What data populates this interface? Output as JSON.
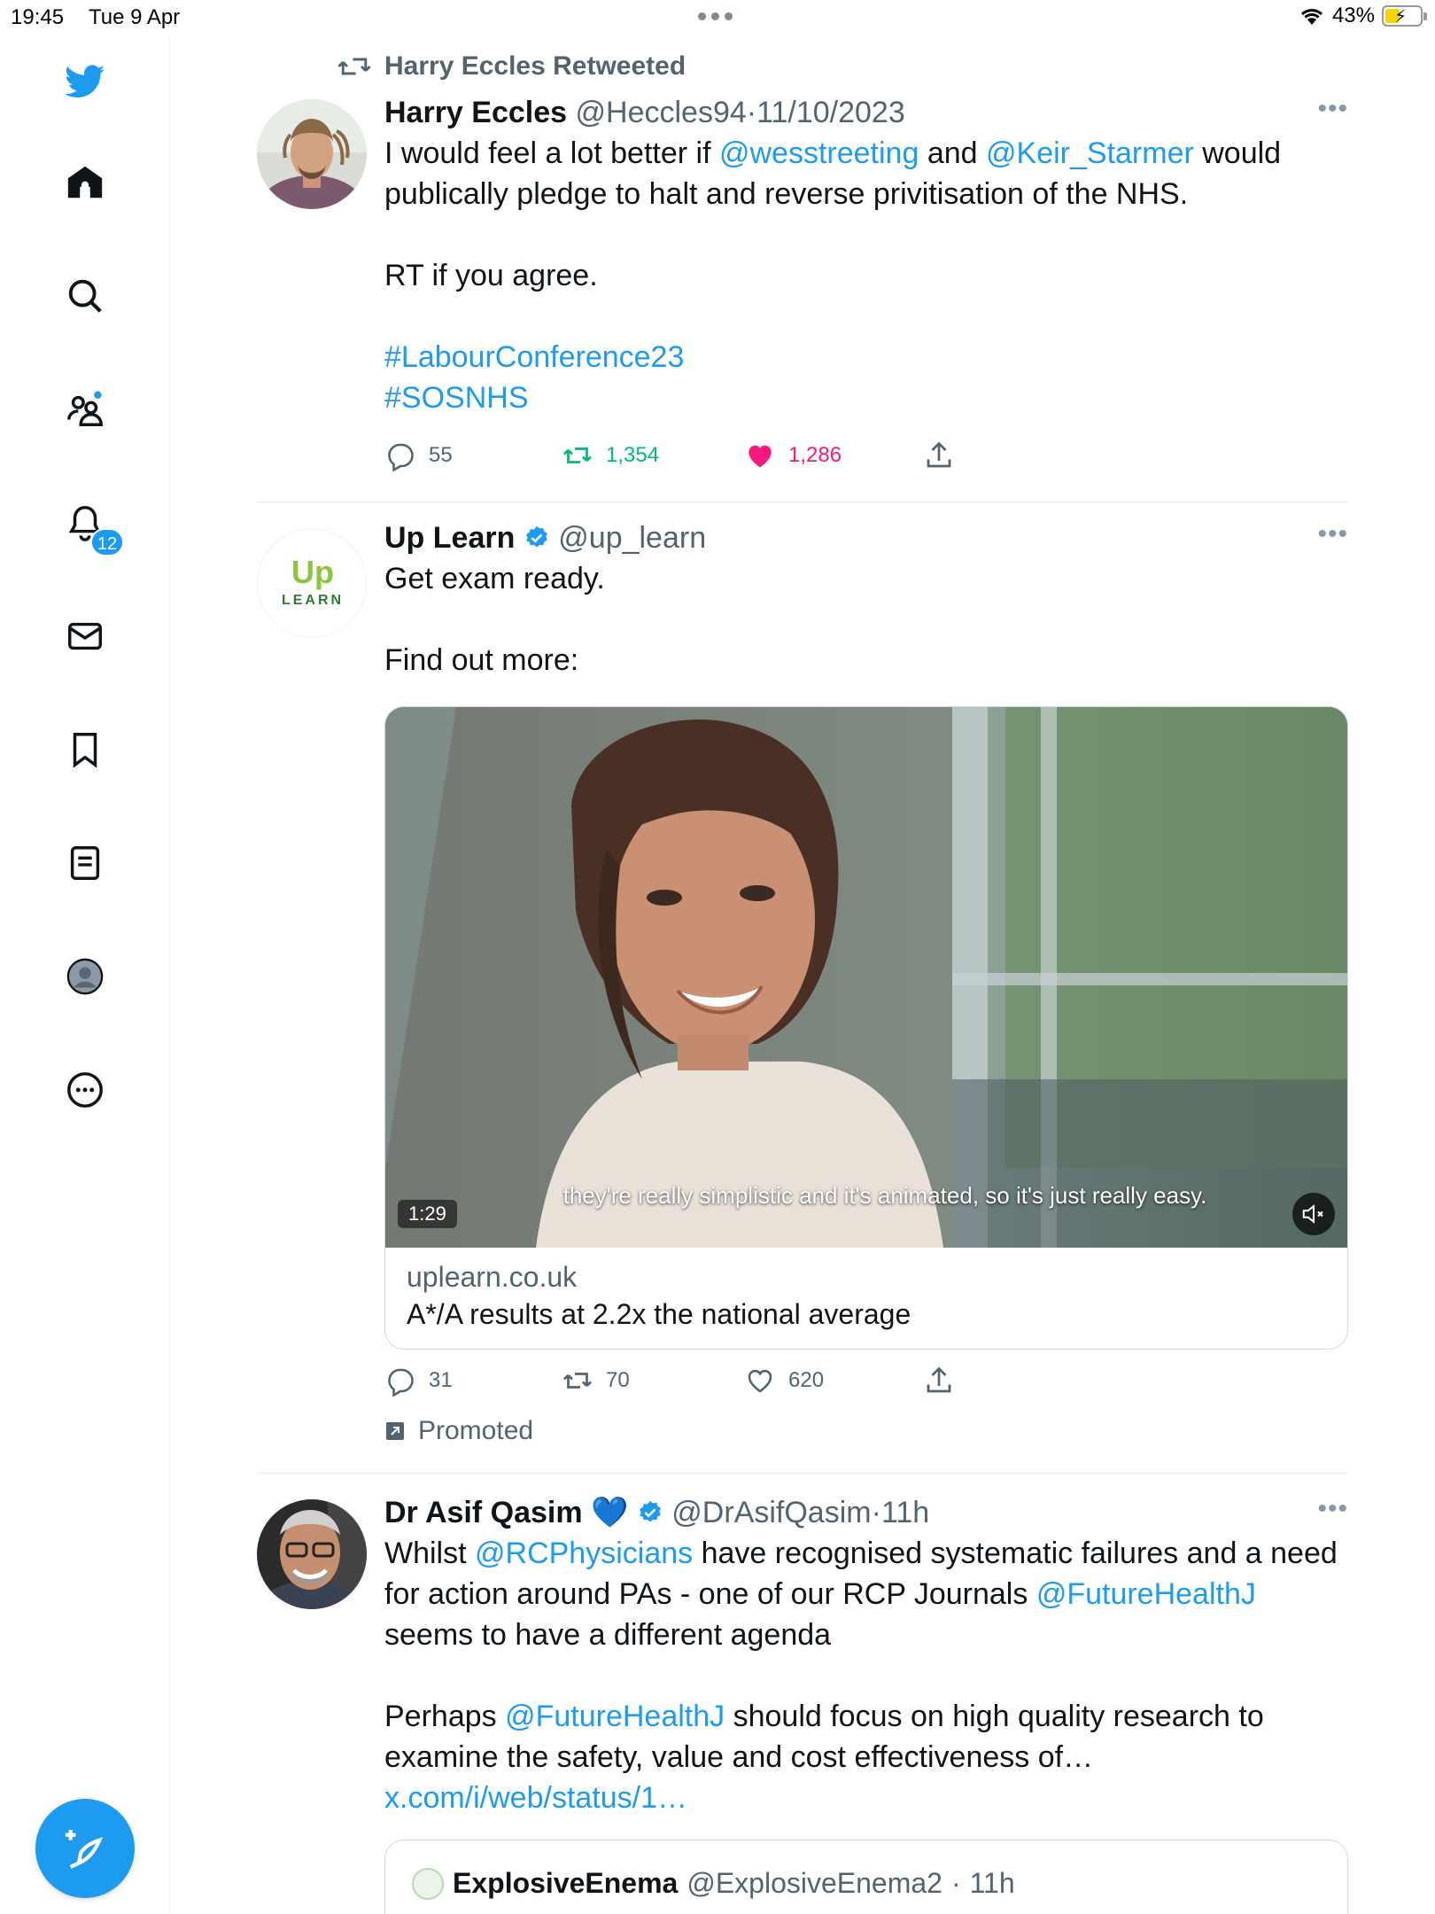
{
  "status_bar": {
    "time": "19:45",
    "date": "Tue 9 Apr",
    "battery": "43%"
  },
  "sidebar": {
    "items": [
      {
        "name": "home",
        "icon": "home-icon"
      },
      {
        "name": "explore",
        "icon": "search-icon"
      },
      {
        "name": "communities",
        "icon": "communities-icon"
      },
      {
        "name": "notifications",
        "icon": "bell-icon",
        "badge": "12"
      },
      {
        "name": "messages",
        "icon": "mail-icon"
      },
      {
        "name": "bookmarks",
        "icon": "bookmark-icon"
      },
      {
        "name": "lists",
        "icon": "list-icon"
      },
      {
        "name": "profile",
        "icon": "profile-icon"
      },
      {
        "name": "more",
        "icon": "more-circle-icon"
      }
    ],
    "accent": "#1d9bf0"
  },
  "tweets": [
    {
      "retweet_label": "Harry Eccles Retweeted",
      "name": "Harry Eccles",
      "handle": "@Heccles94",
      "sep": "·",
      "time": "11/10/2023",
      "text": {
        "p1": "I would feel a lot better if ",
        "m1": "@wesstreeting",
        "p2": " and ",
        "m2": "@Keir_Starmer",
        "p3": " would publically pledge to halt and reverse privitisation of the NHS.",
        "p4": "RT if you agree.",
        "h1": "#LabourConference23",
        "h2": "#SOSNHS"
      },
      "replies": "55",
      "retweets": "1,354",
      "likes": "1,286"
    },
    {
      "name": "Up Learn",
      "handle": "@up_learn",
      "avatar_text_top": "Up",
      "avatar_text_bottom": "LEARN",
      "text": {
        "p1": "Get exam ready.",
        "p2": "Find out more:"
      },
      "video": {
        "caption": "they're really simplistic and it's animated, so it's just really easy.",
        "duration": "1:29"
      },
      "card": {
        "domain": "uplearn.co.uk",
        "title": "A*/A results at 2.2x the national average"
      },
      "replies": "31",
      "retweets": "70",
      "likes": "620",
      "promoted": "Promoted"
    },
    {
      "name": "Dr Asif Qasim",
      "heart": "💙",
      "handle": "@DrAsifQasim",
      "sep": "·",
      "time": "11h",
      "text": {
        "p1": "Whilst ",
        "m1": "@RCPhysicians",
        "p2": " have recognised systematic failures and a need for action around PAs - one of our RCP Journals ",
        "m2": "@FutureHealthJ",
        "p3": " seems to have a different agenda",
        "p4": "Perhaps ",
        "m3": "@FutureHealthJ",
        "p5": " should focus on high quality research to examine the safety, value and cost effectiveness of… ",
        "l1": "x.com/i/web/status/1…"
      },
      "quote": {
        "name": "ExplosiveEnema",
        "handle": "@ExplosiveEnema2",
        "sep": "·",
        "time": "11h"
      }
    }
  ],
  "colors": {
    "like_active": "#f91880",
    "retweet_active": "#00ba7c",
    "link": "#1d9bf0"
  }
}
